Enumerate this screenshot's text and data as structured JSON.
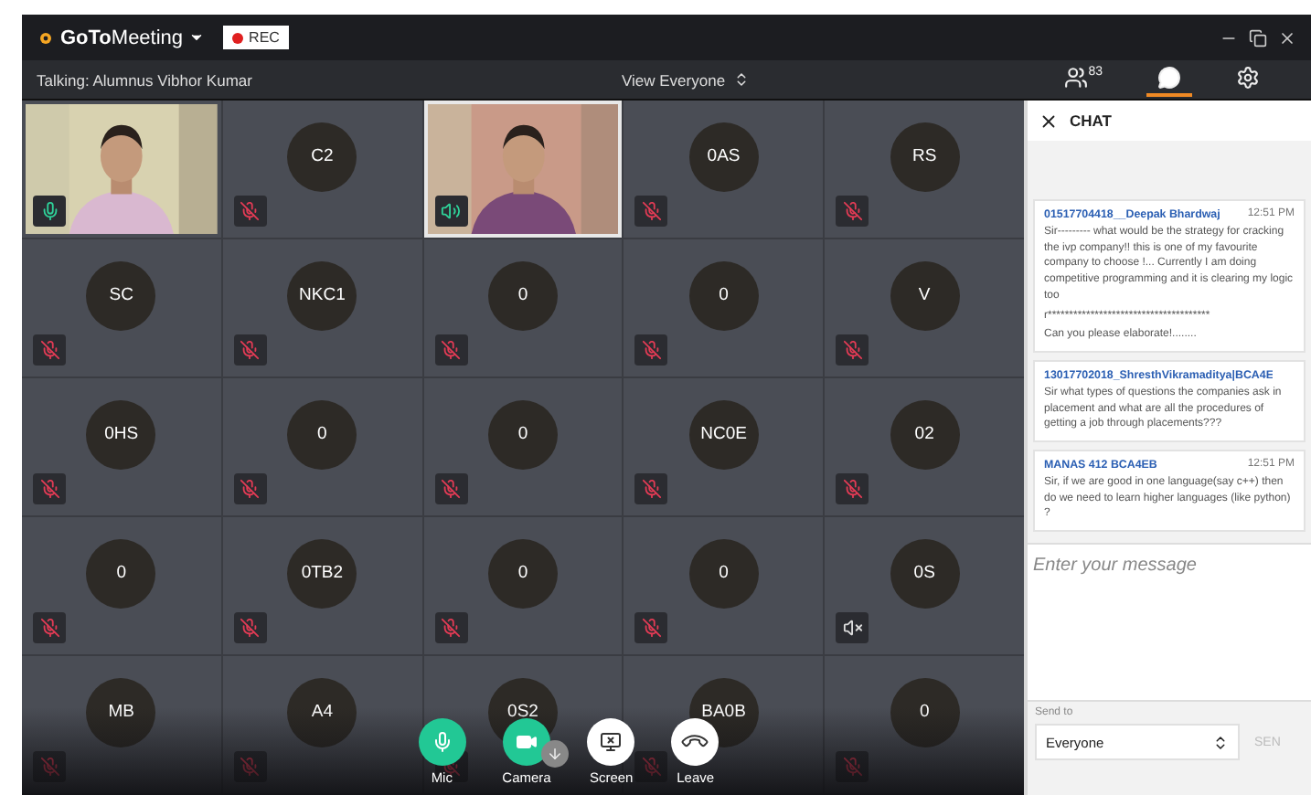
{
  "title_bar": {
    "logo_bold": "GoTo",
    "logo_rest": "Meeting",
    "rec": "REC"
  },
  "info_bar": {
    "talking": "Talking: Alumnus Vibhor Kumar",
    "view": "View Everyone"
  },
  "toolbar": [
    {
      "kind": "participants",
      "count": "83",
      "selected": false
    },
    {
      "kind": "chat",
      "selected": true
    },
    {
      "kind": "settings",
      "selected": false
    }
  ],
  "tiles": [
    {
      "kind": "video",
      "speaker": false,
      "muted": false,
      "highlighted": false
    },
    {
      "kind": "avatar",
      "initials": "C2",
      "speaker": false,
      "muted": true,
      "highlighted": false
    },
    {
      "kind": "video",
      "speaker": true,
      "muted": false,
      "highlighted": true
    },
    {
      "kind": "avatar",
      "initials": "0AS",
      "speaker": false,
      "muted": true,
      "highlighted": false
    },
    {
      "kind": "avatar",
      "initials": "RS",
      "speaker": false,
      "muted": true,
      "highlighted": false
    },
    {
      "kind": "avatar",
      "initials": "SC",
      "speaker": false,
      "muted": true,
      "highlighted": false
    },
    {
      "kind": "avatar",
      "initials": "NKC1",
      "speaker": false,
      "muted": true,
      "highlighted": false
    },
    {
      "kind": "avatar",
      "initials": "0",
      "speaker": false,
      "muted": true,
      "highlighted": false
    },
    {
      "kind": "avatar",
      "initials": "0",
      "speaker": false,
      "muted": true,
      "highlighted": false
    },
    {
      "kind": "avatar",
      "initials": "V",
      "speaker": false,
      "muted": true,
      "highlighted": false
    },
    {
      "kind": "avatar",
      "initials": "0HS",
      "speaker": false,
      "muted": true,
      "highlighted": false
    },
    {
      "kind": "avatar",
      "initials": "0",
      "speaker": false,
      "muted": true,
      "highlighted": false
    },
    {
      "kind": "avatar",
      "initials": "0",
      "speaker": false,
      "muted": true,
      "highlighted": false
    },
    {
      "kind": "avatar",
      "initials": "NC0E",
      "speaker": false,
      "muted": true,
      "highlighted": false
    },
    {
      "kind": "avatar",
      "initials": "02",
      "speaker": false,
      "muted": true,
      "highlighted": false
    },
    {
      "kind": "avatar",
      "initials": "0",
      "speaker": false,
      "muted": true,
      "highlighted": false
    },
    {
      "kind": "avatar",
      "initials": "0TB2",
      "speaker": false,
      "muted": true,
      "highlighted": false
    },
    {
      "kind": "avatar",
      "initials": "0",
      "speaker": false,
      "muted": true,
      "highlighted": false
    },
    {
      "kind": "avatar",
      "initials": "0",
      "speaker": false,
      "muted": true,
      "highlighted": false
    },
    {
      "kind": "avatar",
      "initials": "0S",
      "speaker": true,
      "muted": true,
      "highlighted": false
    },
    {
      "kind": "avatar",
      "initials": "MB",
      "speaker": false,
      "muted": true,
      "highlighted": false
    },
    {
      "kind": "avatar",
      "initials": "A4",
      "speaker": false,
      "muted": true,
      "highlighted": false
    },
    {
      "kind": "avatar",
      "initials": "0S2",
      "speaker": false,
      "muted": true,
      "highlighted": false
    },
    {
      "kind": "avatar",
      "initials": "BA0B",
      "speaker": false,
      "muted": true,
      "highlighted": false
    },
    {
      "kind": "avatar",
      "initials": "0",
      "speaker": false,
      "muted": true,
      "highlighted": false
    }
  ],
  "controls": [
    {
      "kind": "mic",
      "label": "Mic"
    },
    {
      "kind": "camera",
      "label": "Camera"
    },
    {
      "kind": "screen",
      "label": "Screen"
    },
    {
      "kind": "leave",
      "label": "Leave"
    }
  ],
  "chat": {
    "title": "CHAT",
    "messages": [
      {
        "sender": "01517704418__Deepak Bhardwaj",
        "time": "12:51 PM",
        "lines": [
          "Sir--------- what would be the strategy for cracking the ivp  company!!  this is one of my favourite company to choose !...  Currently I am doing competitive programming and it is clearing my logic too",
          "r**************************************",
          "Can you please elaborate!........"
        ]
      },
      {
        "sender": "13017702018_ShresthVikramaditya|BCA4E",
        "lines": [
          "Sir what types of questions the companies ask in placement and what are all the procedures of getting a job through placements???"
        ]
      },
      {
        "sender": "MANAS 412 BCA4EB",
        "time": "12:51 PM",
        "lines": [
          "Sir, if we are good in one language(say c++) then do we need to learn higher languages (like python) ?"
        ]
      }
    ],
    "placeholder": "Enter your message",
    "send_to_label": "Send to",
    "send_to": "Everyone",
    "send": "SEN"
  }
}
